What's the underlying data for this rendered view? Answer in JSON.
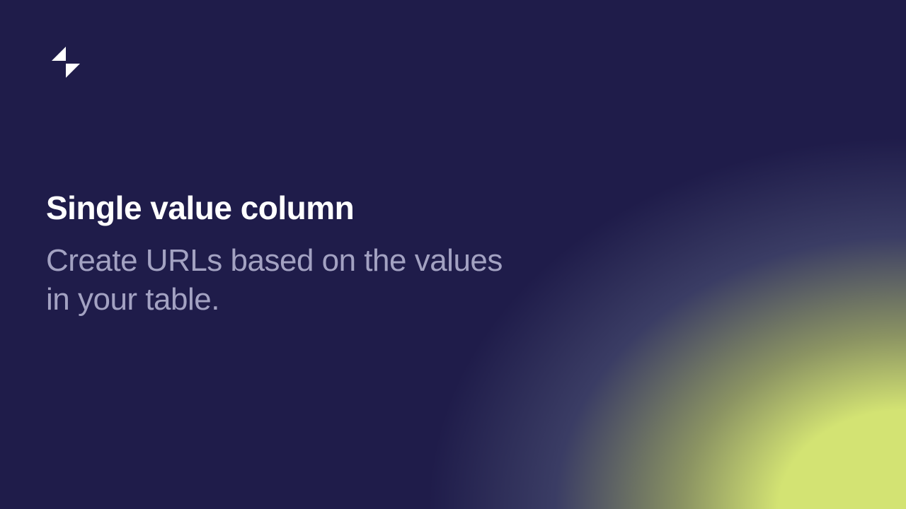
{
  "logo": {
    "name": "glide-logo"
  },
  "hero": {
    "title": "Single value column",
    "subtitle": "Create URLs based on the values in your table."
  },
  "colors": {
    "background": "#1f1c4a",
    "accent": "#d3e373",
    "title": "#ffffff",
    "subtitle": "#a3a2c2"
  }
}
